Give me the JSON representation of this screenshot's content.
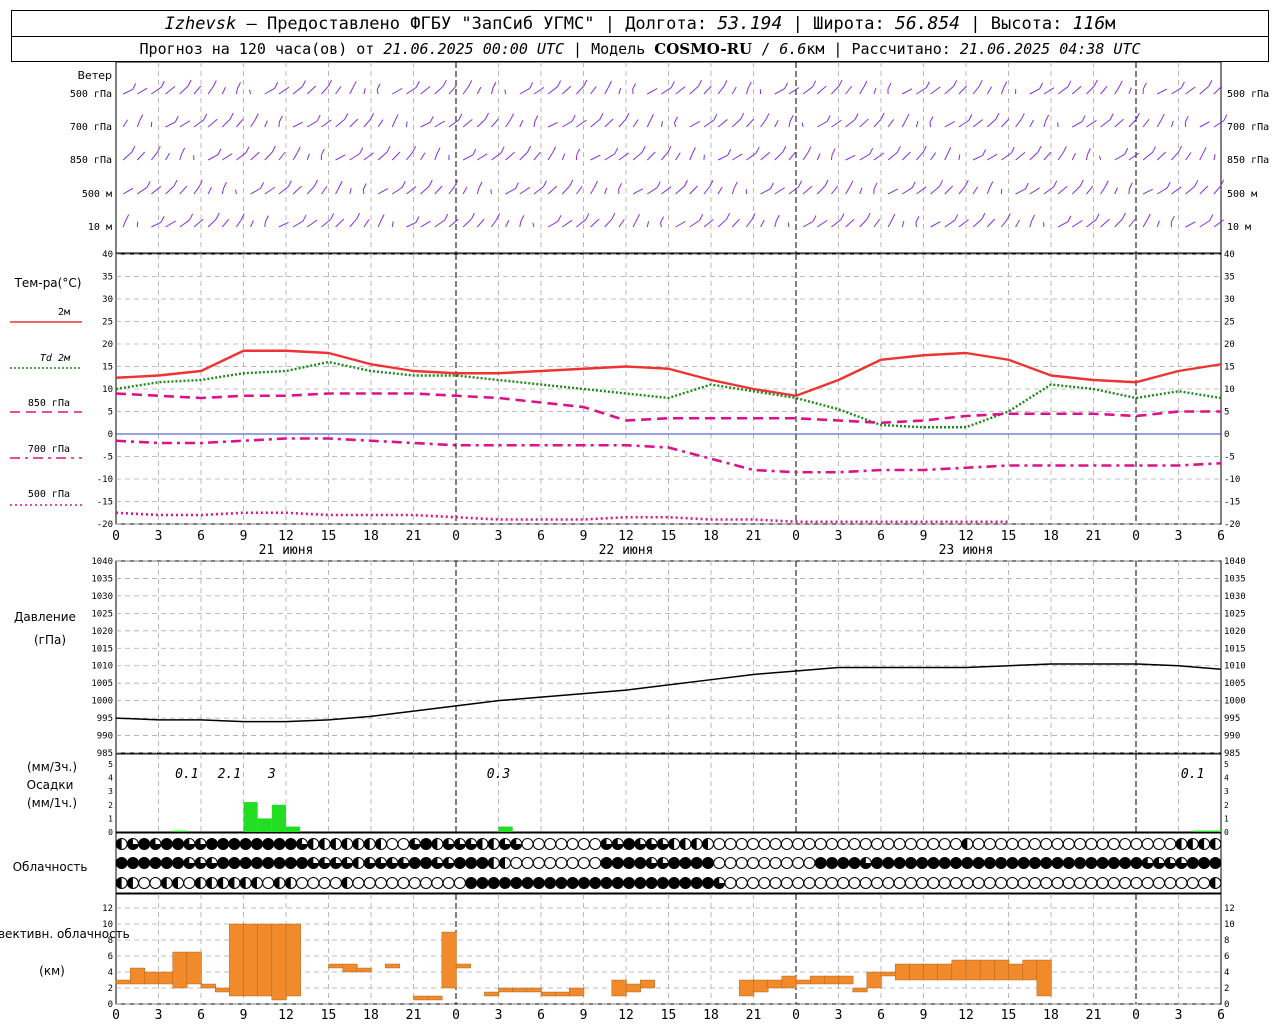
{
  "header": {
    "city": "Izhevsk",
    "provider": "Предоставлено ФГБУ \"ЗапСиб УГМС\"",
    "lon_label": "Долгота:",
    "lon_value": "53.194",
    "lat_label": "Широта:",
    "lat_value": "56.854",
    "alt_label": "Высота:",
    "alt_value": "116",
    "alt_unit": "м",
    "forecast_label": "Прогноз на 120 часа(ов) от",
    "forecast_start": "21.06.2025 00:00 UTC",
    "model_label": "Модель",
    "model_name": "COSMO-RU",
    "model_res": "6.6",
    "model_res_unit": "км",
    "calc_label": "Рассчитано:",
    "calc_time": "21.06.2025 04:38 UTC"
  },
  "colors": {
    "wind": "#8a2be2",
    "t2m": "#ee3333",
    "td2m": "#1a8a1a",
    "t850": "#dd1188",
    "t700": "#dd1188",
    "t500": "#dd1188",
    "pressure": "#000000",
    "precip": "#22dd22",
    "convective": "#f08a2a",
    "grid": "#aaaaaa"
  },
  "hour_labels": [
    "0",
    "3",
    "6",
    "9",
    "12",
    "15",
    "18",
    "21",
    "0",
    "3",
    "6",
    "9",
    "12",
    "15",
    "18",
    "21",
    "0",
    "3",
    "6",
    "9",
    "12",
    "15",
    "18",
    "21",
    "0",
    "3",
    "6"
  ],
  "day_labels": [
    "21 июня",
    "22 июня",
    "23 июня"
  ],
  "wind": {
    "title": "Ветер",
    "levels": [
      "500 гПа",
      "700 гПа",
      "850 гПа",
      "500 м",
      "10 м"
    ]
  },
  "chart_data": [
    {
      "type": "line",
      "title": "Тем-ра(°C)",
      "ylim": [
        -20,
        40
      ],
      "yticks": [
        -20,
        -15,
        -10,
        -5,
        0,
        5,
        10,
        15,
        20,
        25,
        30,
        35,
        40
      ],
      "legend": [
        "2м",
        "Td 2м",
        "850 гПа",
        "700 гПа",
        "500 гПа"
      ],
      "x_hours": [
        0,
        3,
        6,
        9,
        12,
        15,
        18,
        21,
        24,
        27,
        30,
        33,
        36,
        39,
        42,
        45,
        48,
        51,
        54,
        57,
        60,
        63,
        66,
        69,
        72,
        75,
        78
      ],
      "series": [
        {
          "name": "2м",
          "values": [
            12.5,
            13,
            14,
            18.5,
            18.5,
            18,
            15.5,
            14,
            13.5,
            13.5,
            14,
            14.5,
            15,
            14.5,
            12,
            10,
            8.5,
            12,
            16.5,
            17.5,
            18,
            16.5,
            13,
            12,
            11.5,
            14,
            15.5
          ]
        },
        {
          "name": "Td 2м",
          "values": [
            10,
            11.5,
            12,
            13.5,
            14,
            16,
            14,
            13,
            13,
            12,
            11,
            10,
            9,
            8,
            11,
            9.5,
            8,
            5.5,
            2,
            1.5,
            1.5,
            5,
            11,
            10,
            8,
            9.5,
            8
          ]
        },
        {
          "name": "850 гПа",
          "values": [
            9,
            8.5,
            8,
            8.5,
            8.5,
            9,
            9,
            9,
            8.5,
            8,
            7,
            6,
            3,
            3.5,
            3.5,
            3.5,
            3.5,
            3,
            2.5,
            3,
            4,
            4.5,
            4.5,
            4.5,
            4,
            5,
            5
          ]
        },
        {
          "name": "700 гПа",
          "values": [
            -1.5,
            -2,
            -2,
            -1.5,
            -1,
            -1,
            -1.5,
            -2,
            -2.5,
            -2.5,
            -2.5,
            -2.5,
            -2.5,
            -3,
            -5.5,
            -8,
            -8.5,
            -8.5,
            -8,
            -8,
            -7.5,
            -7,
            -7,
            -7,
            -7,
            -7,
            -6.5
          ]
        },
        {
          "name": "500 гПа",
          "values": [
            -17.5,
            -18,
            -18,
            -17.5,
            -17.5,
            -18,
            -18,
            -18,
            -18.5,
            -19,
            -19,
            -19,
            -18.5,
            -18.5,
            -19,
            -19,
            -19.5,
            -19.5,
            -19.5,
            -19.5,
            -19.5,
            -19.5
          ]
        }
      ]
    },
    {
      "type": "line",
      "title": "Давление",
      "ylabel": "(гПа)",
      "ylim": [
        985,
        1040
      ],
      "yticks": [
        985,
        990,
        995,
        1000,
        1005,
        1010,
        1015,
        1020,
        1025,
        1030,
        1035,
        1040
      ],
      "series": [
        {
          "name": "",
          "values": [
            995,
            994.5,
            994.5,
            994,
            994,
            994.5,
            995.5,
            997,
            998.5,
            1000,
            1001,
            1002,
            1003,
            1004.5,
            1006,
            1007.5,
            1008.5,
            1009.5,
            1009.5,
            1009.5,
            1009.5,
            1010,
            1010.5,
            1010.5,
            1010.5,
            1010,
            1009
          ]
        }
      ]
    },
    {
      "type": "bar",
      "title": "Осадки",
      "ylabel_top": "(мм/3ч.)",
      "ylabel_bottom": "(мм/1ч.)",
      "ylim": [
        0,
        5
      ],
      "yticks": [
        0,
        1,
        2,
        3,
        4,
        5
      ],
      "annotations": [
        {
          "hour": 5,
          "text": "0.1"
        },
        {
          "hour": 8,
          "text": "2.1"
        },
        {
          "hour": 11,
          "text": "3"
        },
        {
          "hour": 27,
          "text": "0.3"
        },
        {
          "hour": 76,
          "text": "0.1"
        }
      ],
      "bars": [
        {
          "hour": 4,
          "value": 0.1
        },
        {
          "hour": 9,
          "value": 2.2
        },
        {
          "hour": 10,
          "value": 1
        },
        {
          "hour": 11,
          "value": 2
        },
        {
          "hour": 12,
          "value": 0.4
        },
        {
          "hour": 27,
          "value": 0.4
        },
        {
          "hour": 76,
          "value": 0.1
        },
        {
          "hour": 77,
          "value": 0.1
        }
      ]
    },
    {
      "type": "table",
      "title": "Облачность",
      "rows": [
        [
          2,
          3,
          4,
          3,
          4,
          4,
          3,
          3,
          4,
          4,
          4,
          4,
          4,
          4,
          4,
          4,
          3,
          2,
          2,
          2,
          2,
          2,
          2,
          2,
          1,
          1,
          3,
          4,
          2,
          3,
          3,
          3,
          2,
          2,
          3,
          3,
          1,
          1,
          1,
          1,
          1,
          1,
          1,
          3,
          3,
          4,
          3,
          3,
          3,
          2,
          2,
          2,
          2,
          1,
          1,
          1,
          1,
          1,
          1,
          1,
          1,
          1,
          1,
          1,
          1,
          1,
          1,
          1,
          1,
          1,
          1,
          1,
          1,
          1,
          1,
          2,
          1,
          1,
          1,
          1,
          1,
          1,
          1,
          1,
          1,
          1,
          1,
          1,
          1,
          1,
          1,
          1,
          1,
          1,
          2,
          2,
          2,
          2
        ],
        [
          4,
          4,
          4,
          4,
          4,
          4,
          3,
          3,
          3,
          4,
          4,
          4,
          4,
          4,
          4,
          4,
          4,
          3,
          3,
          3,
          3,
          2,
          3,
          3,
          3,
          3,
          4,
          4,
          3,
          3,
          4,
          4,
          4,
          2,
          2,
          1,
          1,
          1,
          1,
          1,
          1,
          1,
          1,
          4,
          4,
          4,
          4,
          3,
          3,
          4,
          4,
          4,
          4,
          1,
          1,
          1,
          1,
          1,
          1,
          1,
          1,
          1,
          4,
          4,
          4,
          4,
          3,
          4,
          4,
          4,
          4,
          4,
          4,
          4,
          4,
          4,
          4,
          4,
          4,
          4,
          4,
          4,
          4,
          4,
          4,
          4,
          4,
          4,
          4,
          4,
          4,
          3,
          3,
          3,
          3,
          4,
          4,
          4
        ],
        [
          2,
          2,
          1,
          1,
          2,
          2,
          1,
          2,
          2,
          2,
          2,
          2,
          2,
          1,
          2,
          2,
          1,
          1,
          1,
          1,
          2,
          1,
          1,
          1,
          1,
          1,
          1,
          1,
          1,
          1,
          1,
          4,
          4,
          4,
          4,
          4,
          4,
          4,
          4,
          4,
          4,
          4,
          4,
          4,
          4,
          4,
          4,
          4,
          4,
          4,
          4,
          4,
          4,
          3,
          1,
          1,
          1,
          1,
          1,
          1,
          1,
          1,
          1,
          1,
          1,
          1,
          1,
          1,
          1,
          1,
          1,
          1,
          1,
          1,
          1,
          1,
          1,
          1,
          1,
          1,
          1,
          1,
          1,
          1,
          1,
          1,
          1,
          1,
          1,
          1,
          1,
          1,
          1,
          1,
          1,
          1,
          1,
          2
        ]
      ]
    },
    {
      "type": "bar",
      "title": "Конвективн. облачность",
      "ylabel": "(км)",
      "ylim": [
        0,
        13
      ],
      "yticks": [
        0,
        2,
        4,
        6,
        8,
        10,
        12
      ],
      "bars": [
        {
          "hour": 0,
          "base": 2.5,
          "top": 3
        },
        {
          "hour": 1,
          "base": 2.5,
          "top": 4.5
        },
        {
          "hour": 2,
          "base": 2.5,
          "top": 4
        },
        {
          "hour": 3,
          "base": 2.5,
          "top": 4
        },
        {
          "hour": 4,
          "base": 2,
          "top": 6.5
        },
        {
          "hour": 5,
          "base": 2.5,
          "top": 6.5
        },
        {
          "hour": 6,
          "base": 2,
          "top": 2.5
        },
        {
          "hour": 7,
          "base": 1.5,
          "top": 2
        },
        {
          "hour": 8,
          "base": 1,
          "top": 10
        },
        {
          "hour": 9,
          "base": 1,
          "top": 10
        },
        {
          "hour": 10,
          "base": 1,
          "top": 10
        },
        {
          "hour": 11,
          "base": 0.5,
          "top": 10
        },
        {
          "hour": 12,
          "base": 1,
          "top": 10
        },
        {
          "hour": 15,
          "base": 4.5,
          "top": 5
        },
        {
          "hour": 16,
          "base": 4,
          "top": 5
        },
        {
          "hour": 17,
          "base": 4,
          "top": 4.5
        },
        {
          "hour": 19,
          "base": 4.5,
          "top": 5
        },
        {
          "hour": 21,
          "base": 0.5,
          "top": 1
        },
        {
          "hour": 22,
          "base": 0.5,
          "top": 1
        },
        {
          "hour": 23,
          "base": 2,
          "top": 9
        },
        {
          "hour": 24,
          "base": 4.5,
          "top": 5
        },
        {
          "hour": 26,
          "base": 1,
          "top": 1.5
        },
        {
          "hour": 27,
          "base": 1.5,
          "top": 2
        },
        {
          "hour": 28,
          "base": 1.5,
          "top": 2
        },
        {
          "hour": 29,
          "base": 1.5,
          "top": 2
        },
        {
          "hour": 30,
          "base": 1,
          "top": 1.5
        },
        {
          "hour": 31,
          "base": 1,
          "top": 1.5
        },
        {
          "hour": 32,
          "base": 1,
          "top": 2
        },
        {
          "hour": 35,
          "base": 1,
          "top": 3
        },
        {
          "hour": 36,
          "base": 1.5,
          "top": 2.5
        },
        {
          "hour": 37,
          "base": 2,
          "top": 3
        },
        {
          "hour": 44,
          "base": 1,
          "top": 3
        },
        {
          "hour": 45,
          "base": 1.5,
          "top": 3
        },
        {
          "hour": 46,
          "base": 2,
          "top": 3
        },
        {
          "hour": 47,
          "base": 2,
          "top": 3.5
        },
        {
          "hour": 48,
          "base": 2.5,
          "top": 3
        },
        {
          "hour": 49,
          "base": 2.5,
          "top": 3.5
        },
        {
          "hour": 50,
          "base": 2.5,
          "top": 3.5
        },
        {
          "hour": 51,
          "base": 2.5,
          "top": 3.5
        },
        {
          "hour": 52,
          "base": 1.5,
          "top": 2
        },
        {
          "hour": 53,
          "base": 2,
          "top": 4
        },
        {
          "hour": 54,
          "base": 3.5,
          "top": 4
        },
        {
          "hour": 55,
          "base": 3,
          "top": 5
        },
        {
          "hour": 56,
          "base": 3,
          "top": 5
        },
        {
          "hour": 57,
          "base": 3,
          "top": 5
        },
        {
          "hour": 58,
          "base": 3,
          "top": 5
        },
        {
          "hour": 59,
          "base": 3,
          "top": 5.5
        },
        {
          "hour": 60,
          "base": 3,
          "top": 5.5
        },
        {
          "hour": 61,
          "base": 3,
          "top": 5.5
        },
        {
          "hour": 62,
          "base": 3,
          "top": 5.5
        },
        {
          "hour": 63,
          "base": 3,
          "top": 5
        },
        {
          "hour": 64,
          "base": 3,
          "top": 5.5
        },
        {
          "hour": 65,
          "base": 1,
          "top": 5.5
        }
      ]
    }
  ]
}
